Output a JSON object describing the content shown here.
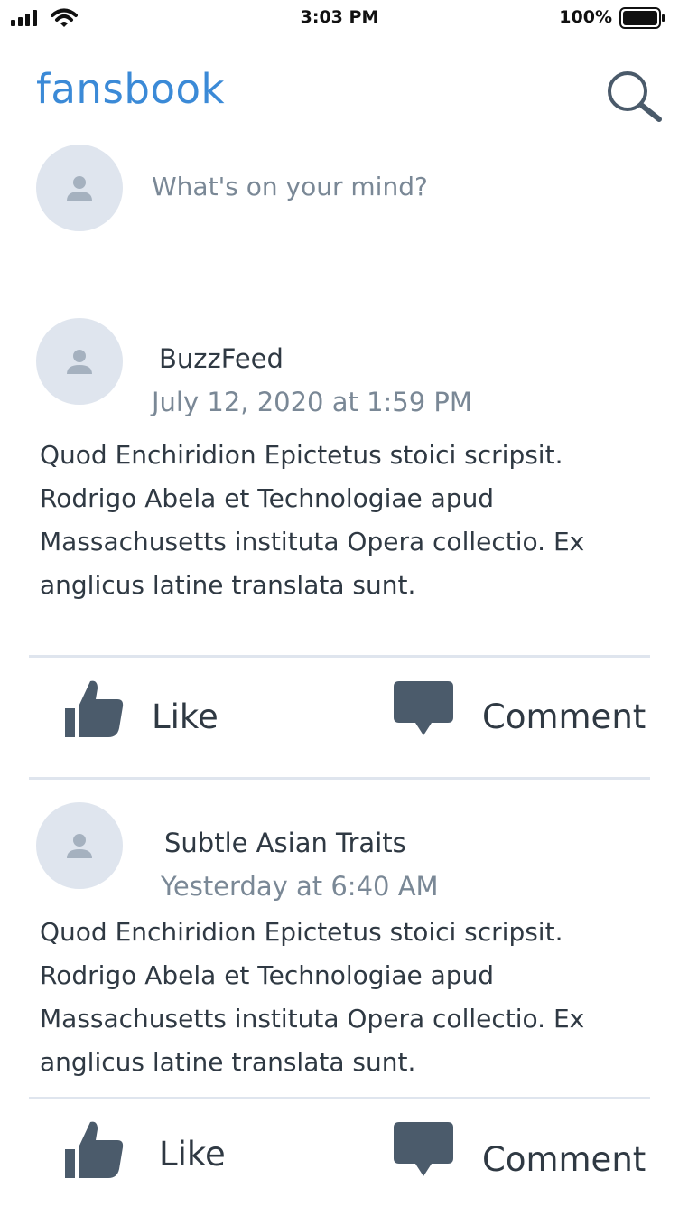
{
  "status_bar": {
    "time": "3:03 PM",
    "battery": "100%",
    "icons": [
      "signal-icon",
      "wifi-icon",
      "battery-icon"
    ]
  },
  "header": {
    "brand": "fansbook",
    "brand_color": "#3b8ad7",
    "search_icon": "search-icon"
  },
  "composer": {
    "placeholder": "What's on your mind?"
  },
  "posts": [
    {
      "author": "BuzzFeed",
      "timestamp": "July 12, 2020 at 1:59 PM",
      "body": "Quod Enchiridion Epictetus stoici scripsit. Rodrigo Abela et Technologiae apud Massachusetts instituta Opera collectio. Ex anglicus latine translata sunt.",
      "like_label": "Like",
      "comment_label": "Comment"
    },
    {
      "author": "Subtle Asian Traits",
      "timestamp": "Yesterday at 6:40 AM",
      "body": "Quod Enchiridion Epictetus stoici scripsit. Rodrigo Abela et Technologiae apud Massachusetts instituta Opera collectio. Ex anglicus latine translata sunt.",
      "like_label": "Like",
      "comment_label": "Comment"
    }
  ]
}
